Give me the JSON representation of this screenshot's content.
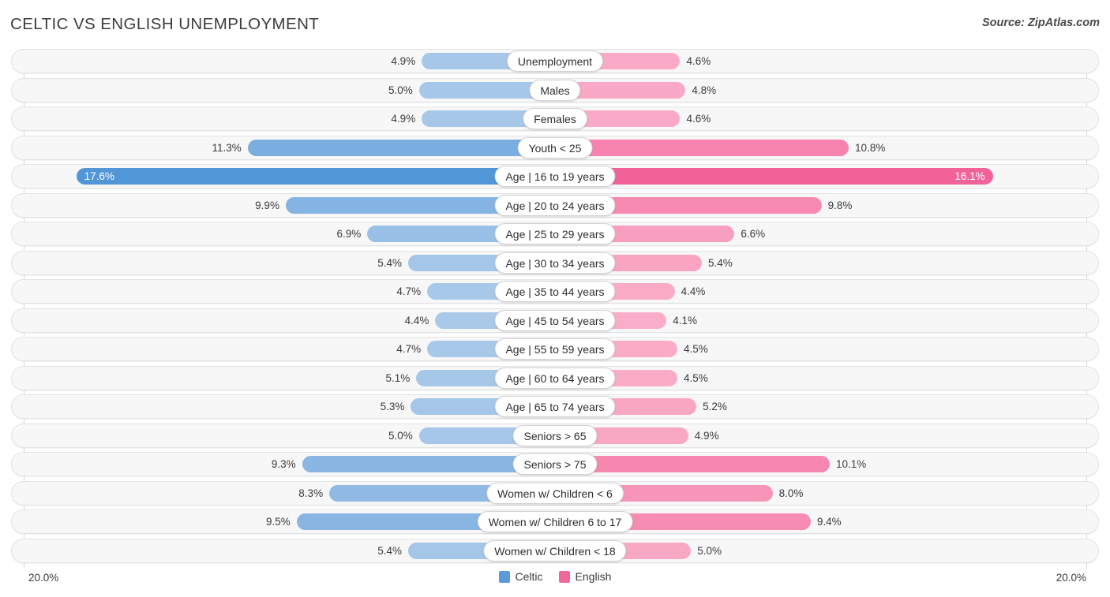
{
  "header": {
    "title": "CELTIC VS ENGLISH UNEMPLOYMENT",
    "source": "Source: ZipAtlas.com"
  },
  "axis": {
    "left_label": "20.0%",
    "right_label": "20.0%",
    "max": 20.0
  },
  "legend": {
    "items": [
      {
        "label": "Celtic",
        "color": "#5b9bd9"
      },
      {
        "label": "English",
        "color": "#f2679a"
      }
    ]
  },
  "chart_data": {
    "type": "bar",
    "subtype": "diverging-bidirectional",
    "title": "CELTIC VS ENGLISH UNEMPLOYMENT",
    "xlabel": "",
    "ylabel": "",
    "xlim": [
      20.0,
      20.0
    ],
    "grid": true,
    "legend_position": "bottom-center",
    "unit": "%",
    "categories": [
      "Unemployment",
      "Males",
      "Females",
      "Youth < 25",
      "Age | 16 to 19 years",
      "Age | 20 to 24 years",
      "Age | 25 to 29 years",
      "Age | 30 to 34 years",
      "Age | 35 to 44 years",
      "Age | 45 to 54 years",
      "Age | 55 to 59 years",
      "Age | 60 to 64 years",
      "Age | 65 to 74 years",
      "Seniors > 65",
      "Seniors > 75",
      "Women w/ Children < 6",
      "Women w/ Children 6 to 17",
      "Women w/ Children < 18"
    ],
    "series": [
      {
        "name": "Celtic",
        "side": "left",
        "color": "#5b9bd9",
        "values": [
          4.9,
          5.0,
          4.9,
          11.3,
          17.6,
          9.9,
          6.9,
          5.4,
          4.7,
          4.4,
          4.7,
          5.1,
          5.3,
          5.0,
          9.3,
          8.3,
          9.5,
          5.4
        ],
        "labels": [
          "4.9%",
          "5.0%",
          "4.9%",
          "11.3%",
          "17.6%",
          "9.9%",
          "6.9%",
          "5.4%",
          "4.7%",
          "4.4%",
          "4.7%",
          "5.1%",
          "5.3%",
          "5.0%",
          "9.3%",
          "8.3%",
          "9.5%",
          "5.4%"
        ]
      },
      {
        "name": "English",
        "side": "right",
        "color": "#f2679a",
        "values": [
          4.6,
          4.8,
          4.6,
          10.8,
          16.1,
          9.8,
          6.6,
          5.4,
          4.4,
          4.1,
          4.5,
          4.5,
          5.2,
          4.9,
          10.1,
          8.0,
          9.4,
          5.0
        ],
        "labels": [
          "4.6%",
          "4.8%",
          "4.6%",
          "10.8%",
          "16.1%",
          "9.8%",
          "6.6%",
          "5.4%",
          "4.4%",
          "4.1%",
          "4.5%",
          "4.5%",
          "5.2%",
          "4.9%",
          "10.1%",
          "8.0%",
          "9.4%",
          "5.0%"
        ]
      }
    ]
  }
}
